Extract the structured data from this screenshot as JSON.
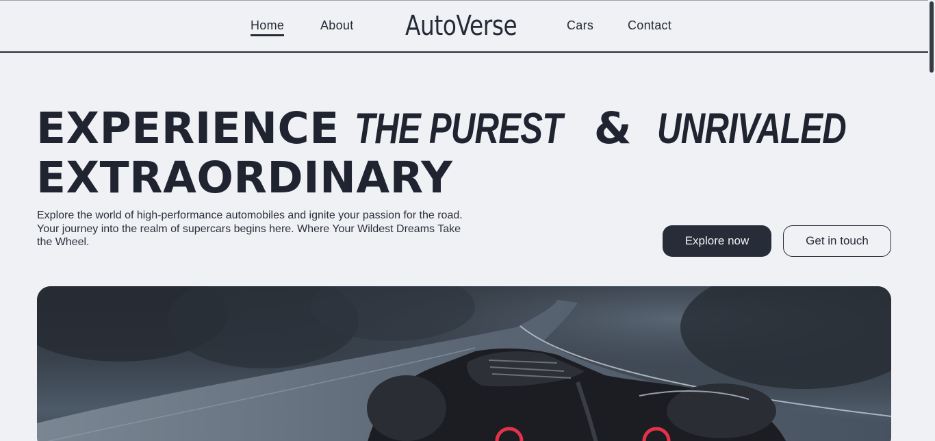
{
  "nav": {
    "home": "Home",
    "about": "About",
    "logo": "AutoVerse",
    "cars": "Cars",
    "contact": "Contact"
  },
  "hero": {
    "headline_1": "EXPERIENCE",
    "headline_em1": "THE PUREST",
    "headline_amp": "&",
    "headline_em2": "UNRIVALED",
    "headline_2": "EXTRAORDINARY",
    "description": "Explore the world of high-performance automobiles and ignite your passion for the road. Your journey into the realm of supercars begins here. Where Your Wildest Dreams Take the Wheel.",
    "primary_button": "Explore now",
    "secondary_button": "Get in touch"
  },
  "colors": {
    "background": "#eff1f5",
    "text": "#1f2430",
    "primary_button": "#272c39"
  }
}
